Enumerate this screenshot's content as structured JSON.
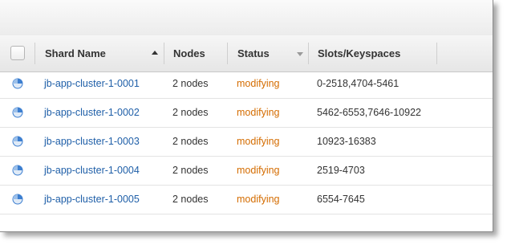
{
  "table": {
    "columns": {
      "shard_name": "Shard Name",
      "nodes": "Nodes",
      "status": "Status",
      "slots": "Slots/Keyspaces"
    },
    "rows": [
      {
        "name": "jb-app-cluster-1-0001",
        "nodes": "2 nodes",
        "status": "modifying",
        "slots": "0-2518,4704-5461"
      },
      {
        "name": "jb-app-cluster-1-0002",
        "nodes": "2 nodes",
        "status": "modifying",
        "slots": "5462-6553,7646-10922"
      },
      {
        "name": "jb-app-cluster-1-0003",
        "nodes": "2 nodes",
        "status": "modifying",
        "slots": "10923-16383"
      },
      {
        "name": "jb-app-cluster-1-0004",
        "nodes": "2 nodes",
        "status": "modifying",
        "slots": "2519-4703"
      },
      {
        "name": "jb-app-cluster-1-0005",
        "nodes": "2 nodes",
        "status": "modifying",
        "slots": "6554-7645"
      }
    ]
  },
  "colors": {
    "link": "#1f5fa8",
    "status_modifying": "#d46c00",
    "spinner": "#3d7fd0"
  },
  "icons": {
    "row_status": "loading-spinner-icon",
    "sort_ascending": "sort-up-icon",
    "sort_menu": "sort-down-icon"
  }
}
